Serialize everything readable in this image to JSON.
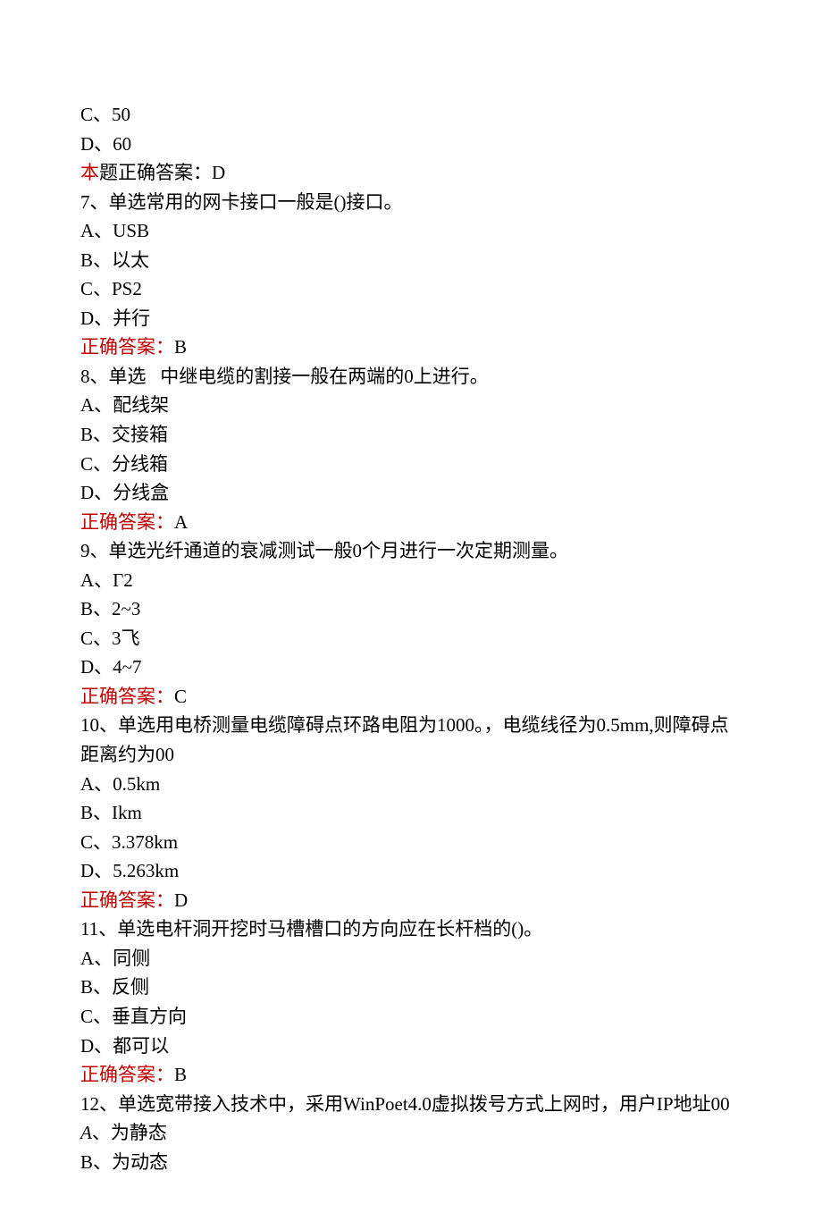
{
  "lines": [
    {
      "text": "C、50"
    },
    {
      "text": "D、60"
    },
    {
      "spans": [
        {
          "text": "本",
          "class": "red"
        },
        {
          "text": "题正确答案：",
          "class": "black"
        },
        {
          "text": "D"
        }
      ]
    },
    {
      "text": "7、单选常用的网卡接口一般是()接口。"
    },
    {
      "text": "A、USB"
    },
    {
      "text": "B、以太"
    },
    {
      "text": "C、PS2"
    },
    {
      "text": "D、并行"
    },
    {
      "spans": [
        {
          "text": "正确答案：",
          "class": "red"
        },
        {
          "text": "B"
        }
      ]
    },
    {
      "text": "8、单选   中继电缆的割接一般在两端的0上进行。"
    },
    {
      "text": "A、配线架"
    },
    {
      "text": "B、交接箱"
    },
    {
      "text": "C、分线箱"
    },
    {
      "text": "D、分线盒"
    },
    {
      "spans": [
        {
          "text": "正确答案：",
          "class": "red"
        },
        {
          "text": "A"
        }
      ]
    },
    {
      "text": "9、单选光纤通道的衰减测试一般0个月进行一次定期测量。"
    },
    {
      "text": "A、Γ2"
    },
    {
      "text": "B、2~3"
    },
    {
      "text": "C、3飞"
    },
    {
      "text": "D、4~7"
    },
    {
      "spans": [
        {
          "text": "正确答案：",
          "class": "red"
        },
        {
          "text": "C"
        }
      ]
    },
    {
      "text": "10、单选用电桥测量电缆障碍点环路电阻为1000。，电缆线径为0.5mm,则障碍点距离约为00"
    },
    {
      "text": "A、0.5km"
    },
    {
      "text": "B、Ikm"
    },
    {
      "text": "C、3.378km"
    },
    {
      "text": "D、5.263km"
    },
    {
      "spans": [
        {
          "text": "正确答案：",
          "class": "red"
        },
        {
          "text": "D"
        }
      ]
    },
    {
      "text": "11、单选电杆洞开挖时马槽槽口的方向应在长杆档的()。"
    },
    {
      "text": "A、同侧"
    },
    {
      "text": "B、反侧"
    },
    {
      "text": "C、垂直方向"
    },
    {
      "text": "D、都可以"
    },
    {
      "spans": [
        {
          "text": "正确答案：",
          "class": "red"
        },
        {
          "text": "B"
        }
      ]
    },
    {
      "text": "12、单选宽带接入技术中，采用WinPoet4.0虚拟拨号方式上网时，用户IP地址00"
    },
    {
      "spans": [
        {
          "text": "A",
          "class": "italic"
        },
        {
          "text": "、为静态"
        }
      ]
    },
    {
      "text": "B、为动态"
    }
  ]
}
